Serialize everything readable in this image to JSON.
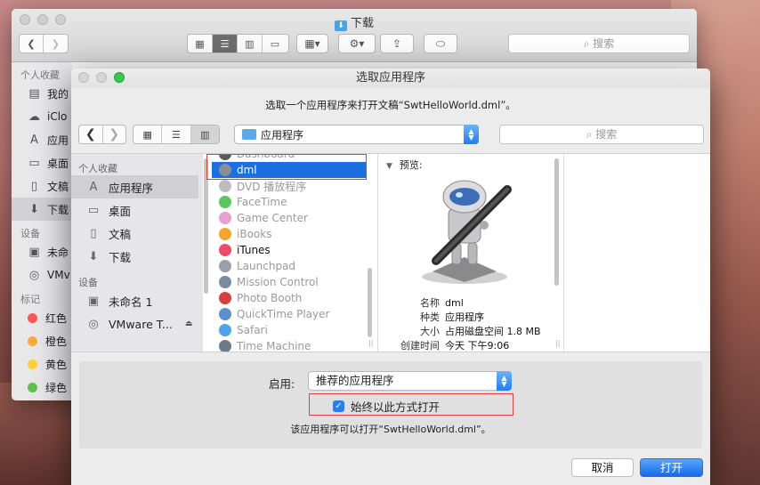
{
  "finder": {
    "title": "下载",
    "search_placeholder": "搜索",
    "sidebar_favorites": "个人收藏",
    "sidebar_items": [
      "我的",
      "iClo",
      "应用",
      "桌面",
      "文稿",
      "下载"
    ],
    "devices_head": "设备",
    "devices": [
      "未命",
      "VMv"
    ],
    "tags_head": "标记",
    "tags": [
      {
        "label": "红色",
        "color": "#fc5753"
      },
      {
        "label": "橙色",
        "color": "#fdaa3a"
      },
      {
        "label": "黄色",
        "color": "#fdd13b"
      },
      {
        "label": "绿色",
        "color": "#5cc34b"
      }
    ]
  },
  "dialog": {
    "title": "选取应用程序",
    "subtitle": "选取一个应用程序来打开文稿“SwtHelloWorld.dml”。",
    "location": "应用程序",
    "search_placeholder": "搜索",
    "sidebar": {
      "favorites_head": "个人收藏",
      "favorites": [
        "应用程序",
        "桌面",
        "文稿",
        "下载"
      ],
      "devices_head": "设备",
      "devices": [
        "未命名 1",
        "VMware T..."
      ]
    },
    "apps": [
      {
        "name": "Dashboard",
        "enabled": false,
        "color": "#5a5a5a"
      },
      {
        "name": "dml",
        "enabled": true,
        "selected": true,
        "color": "#8a8f96"
      },
      {
        "name": "DVD 播放程序",
        "enabled": false,
        "color": "#bdbdbd"
      },
      {
        "name": "FaceTime",
        "enabled": false,
        "color": "#5cc65c"
      },
      {
        "name": "Game Center",
        "enabled": false,
        "color": "#e8a0d0"
      },
      {
        "name": "iBooks",
        "enabled": false,
        "color": "#f5a52b"
      },
      {
        "name": "iTunes",
        "enabled": true,
        "color": "#f04a6a"
      },
      {
        "name": "Launchpad",
        "enabled": false,
        "color": "#9aa0a8"
      },
      {
        "name": "Mission Control",
        "enabled": false,
        "color": "#7a8aa0"
      },
      {
        "name": "Photo Booth",
        "enabled": false,
        "color": "#d44040"
      },
      {
        "name": "QuickTime Player",
        "enabled": false,
        "color": "#5a8fd0"
      },
      {
        "name": "Safari",
        "enabled": false,
        "color": "#4fa3e8"
      },
      {
        "name": "Time Machine",
        "enabled": false,
        "color": "#6a7a8a"
      }
    ],
    "preview": {
      "label": "预览:",
      "name_key": "名称",
      "name_val": "dml",
      "kind_key": "种类",
      "kind_val": "应用程序",
      "size_key": "大小",
      "size_val": "占用磁盘空间 1.8 MB",
      "created_key": "创建时间",
      "created_val": "今天 下午9:06"
    },
    "enable_label": "启用:",
    "enable_value": "推荐的应用程序",
    "always_open": "始终以此方式打开",
    "always_open_checked": true,
    "note": "该应用程序可以打开“SwtHelloWorld.dml”。",
    "cancel": "取消",
    "open": "打开"
  }
}
